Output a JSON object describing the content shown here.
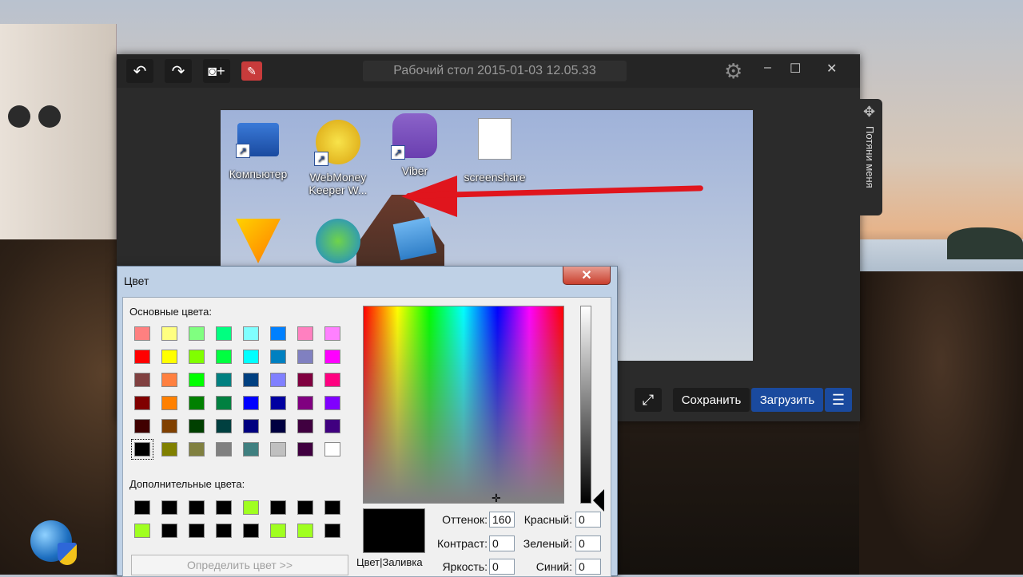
{
  "app": {
    "title": "Рабочий стол 2015-01-03 12.05.33",
    "undo_icon": "undo-icon",
    "redo_icon": "redo-icon",
    "camera_icon": "camera-plus-icon",
    "tool_icon": "image-edit-icon",
    "settings_icon": "gear-icon",
    "window_controls": {
      "minimize": "–",
      "maximize": "☐",
      "close": "✕"
    },
    "side_tab_label": "Потяни меня",
    "buttons": {
      "save": "Сохранить",
      "upload": "Загрузить"
    }
  },
  "screenshot_icons": [
    {
      "label": "Компьютер",
      "icon": "computer-icon"
    },
    {
      "label": "WebMoney Keeper W...",
      "icon": "webmoney-icon"
    },
    {
      "label": "Viber",
      "icon": "viber-icon"
    },
    {
      "label": "screenshare",
      "icon": "java-file-icon"
    }
  ],
  "colors": {
    "accent_blue": "#1a4a9e",
    "arrow_red": "#e0151d",
    "dialog_frame": "#bfd1e6"
  },
  "dialog": {
    "title": "Цвет",
    "close": "✕",
    "basic_label": "Основные цвета:",
    "custom_label": "Дополнительные цвета:",
    "define_button": "Определить цвет >>",
    "preview_label": "Цвет|Заливка",
    "basic_colors": [
      [
        "#ff8080",
        "#ffff80",
        "#80ff80",
        "#00ff80",
        "#80ffff",
        "#0080ff",
        "#ff80c0",
        "#ff80ff"
      ],
      [
        "#ff0000",
        "#ffff00",
        "#80ff00",
        "#00ff40",
        "#00ffff",
        "#0080c0",
        "#8080c0",
        "#ff00ff"
      ],
      [
        "#804040",
        "#ff8040",
        "#00ff00",
        "#008080",
        "#004080",
        "#8080ff",
        "#800040",
        "#ff0080"
      ],
      [
        "#800000",
        "#ff8000",
        "#008000",
        "#008040",
        "#0000ff",
        "#0000a0",
        "#800080",
        "#8000ff"
      ],
      [
        "#400000",
        "#804000",
        "#004000",
        "#004040",
        "#000080",
        "#000040",
        "#400040",
        "#400080"
      ],
      [
        "#000000",
        "#808000",
        "#808040",
        "#808080",
        "#408080",
        "#c0c0c0",
        "#400040",
        "#ffffff"
      ]
    ],
    "custom_colors": [
      [
        "#000000",
        "#000000",
        "#000000",
        "#000000",
        "#a0ff20",
        "#000000",
        "#000000",
        "#000000"
      ],
      [
        "#a0ff20",
        "#000000",
        "#000000",
        "#000000",
        "#000000",
        "#a0ff20",
        "#a0ff20",
        "#000000"
      ]
    ],
    "fields": {
      "hue": {
        "label": "Оттенок:",
        "value": "160"
      },
      "sat": {
        "label": "Контраст:",
        "value": "0"
      },
      "lum": {
        "label": "Яркость:",
        "value": "0"
      },
      "red": {
        "label": "Красный:",
        "value": "0"
      },
      "green": {
        "label": "Зеленый:",
        "value": "0"
      },
      "blue": {
        "label": "Синий:",
        "value": "0"
      }
    }
  }
}
